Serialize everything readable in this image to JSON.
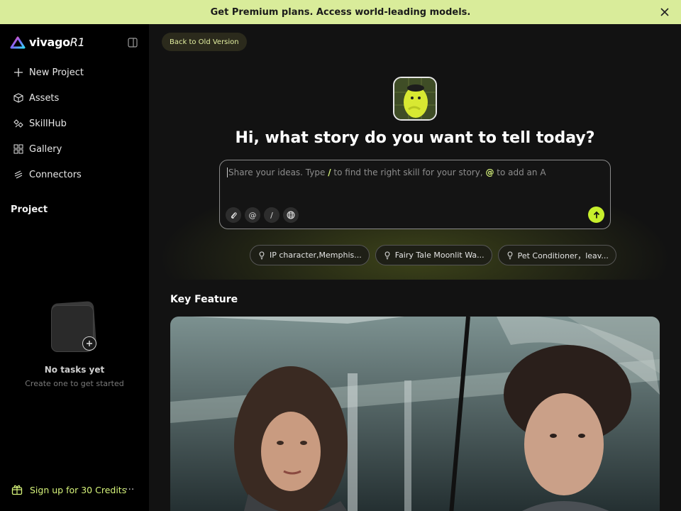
{
  "banner": {
    "text": "Get Premium plans. Access world-leading models."
  },
  "sidebar": {
    "logo": {
      "name": "vivago",
      "suffix": "R1"
    },
    "items": [
      {
        "label": "New Project",
        "icon": "plus-icon"
      },
      {
        "label": "Assets",
        "icon": "cube-icon"
      },
      {
        "label": "SkillHub",
        "icon": "skill-icon"
      },
      {
        "label": "Gallery",
        "icon": "grid-icon"
      },
      {
        "label": "Connectors",
        "icon": "connector-icon"
      }
    ],
    "project_label": "Project",
    "empty_title": "No tasks yet",
    "empty_sub": "Create one to get started",
    "signup": "Sign up for 30 Credits",
    "more": "···"
  },
  "main": {
    "back_label": "Back to Old Version",
    "headline": "Hi, what story do you want to tell today?",
    "prompt": {
      "p1": "Share your ideas. Type ",
      "slash": "/",
      "p2": " to find the right skill for your story, ",
      "at": "@",
      "p3": " to add an A"
    },
    "tools": [
      {
        "icon": "paperclip-icon",
        "glyph": ""
      },
      {
        "icon": "at-icon",
        "glyph": "@"
      },
      {
        "icon": "slash-icon",
        "glyph": "/"
      },
      {
        "icon": "globe-icon",
        "glyph": ""
      }
    ],
    "chips": [
      "IP character,Memphis...",
      "Fairy Tale Moonlit Wa...",
      "Pet Conditioner，leav..."
    ],
    "key_feature": "Key Feature"
  },
  "colors": {
    "accent": "#c7ef2c",
    "banner": "#d9ec9a",
    "sidebar": "#000000",
    "background": "#121212"
  }
}
